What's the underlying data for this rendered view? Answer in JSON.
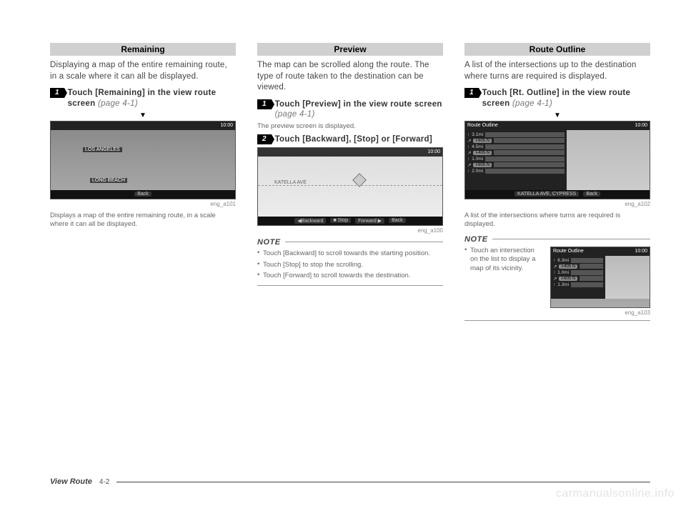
{
  "col1": {
    "header": "Remaining",
    "intro": "Displaying a map of the entire remaining route, in a scale where it can all be displayed.",
    "step1_num": "1",
    "step1_a": "Touch [Remaining] in the view route screen ",
    "step1_b": "(page 4-1)",
    "arrow": "▼",
    "shot": {
      "time": "10:00",
      "back": "Back",
      "place1": "LOS ANGELES",
      "place2": "LONG BEACH"
    },
    "img_id": "eng_a101",
    "caption": "Displays a map of the entire remaining route, in a scale where it can all be displayed."
  },
  "col2": {
    "header": "Preview",
    "intro": "The map can be scrolled along the route. The type of route taken to the destination can be viewed.",
    "step1_num": "1",
    "step1_a": "Touch [Preview] in the view route screen ",
    "step1_b": "(page 4-1)",
    "sub1": "The preview screen is displayed.",
    "step2_num": "2",
    "step2_a": "Touch [Backward], [Stop] or [Forward]",
    "shot": {
      "time": "10:00",
      "street": "KATELLA AVE",
      "b1": "◀Backward",
      "b2": "■ Stop",
      "b3": "Forward ▶",
      "b4": "Back"
    },
    "img_id": "eng_a100",
    "note_title": "NOTE",
    "note1": "Touch [Backward] to scroll towards the starting position.",
    "note2": "Touch [Stop] to stop the scrolling.",
    "note3": "Touch [Forward] to scroll towards the destination."
  },
  "col3": {
    "header": "Route Outline",
    "intro": "A list of the intersections up to the destination where turns are required is displayed.",
    "step1_num": "1",
    "step1_a": "Touch [Rt. Outline] in the view route screen ",
    "step1_b": "(page 4-1)",
    "arrow": "▼",
    "shot1": {
      "title": "Route Outline",
      "time": "10:00",
      "r1_mi": "3.1mi",
      "r1_rd": "I-605 N",
      "r2_mi": "4.5mi",
      "r2_rd": "I-405 N",
      "r3_mi": "1.0mi",
      "r3_rd": "I-605 N",
      "r4_mi": "2.0mi",
      "btm_a": "KATELLA AVE, CYPRESS",
      "btm_b": "Back"
    },
    "img_id1": "eng_a102",
    "caption": "A list of the intersections where turns are required is displayed.",
    "note_title": "NOTE",
    "note1": "Touch an intersection on the list to display a map of its vicinity.",
    "shot2": {
      "title": "Route Outline",
      "time": "10:00",
      "r1_mi": "6.3mi",
      "r1_rd": "",
      "r2_mi": "",
      "r2_rd": "I-405 N",
      "r3_mi": "1.0mi",
      "r3_rd": "I-605 N",
      "r4_mi": "1.3mi"
    },
    "img_id2": "eng_a103"
  },
  "footer": {
    "title": "View Route",
    "page": "4-2"
  },
  "watermark": "carmanualsonline.info"
}
